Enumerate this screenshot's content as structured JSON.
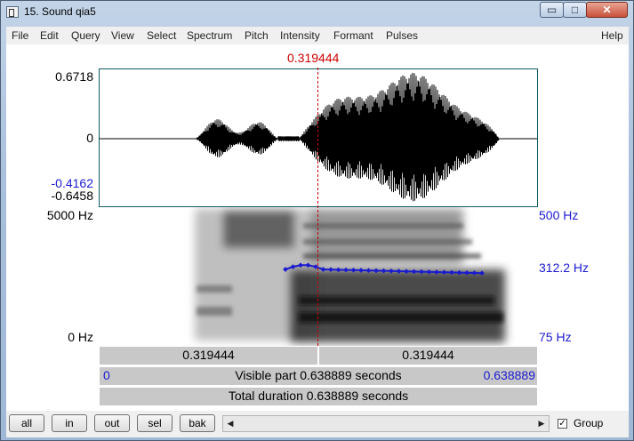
{
  "window": {
    "title": "15. Sound qia5",
    "min": "▭",
    "max": "□",
    "close": "✕"
  },
  "menu": [
    "File",
    "Edit",
    "Query",
    "View",
    "Select",
    "Spectrum",
    "Pitch",
    "Intensity",
    "Formant",
    "Pulses",
    "Help"
  ],
  "cursor": {
    "time": "0.319444"
  },
  "waveform": {
    "top": "0.6718",
    "zero": "0",
    "sel_min": "-0.4162",
    "min": "-0.6458"
  },
  "spectrogram": {
    "top": "5000 Hz",
    "bottom": "0 Hz"
  },
  "pitch": {
    "top": "500 Hz",
    "value": "312.2 Hz",
    "bottom": "75 Hz",
    "color": "#1a1ad0"
  },
  "bars": {
    "left_segment": "0.319444",
    "right_segment": "0.319444",
    "visible_start": "0",
    "visible_text": "Visible part 0.638889 seconds",
    "visible_end": "0.638889",
    "total_text": "Total duration 0.638889 seconds"
  },
  "buttons": {
    "all": "all",
    "in": "in",
    "out": "out",
    "sel": "sel",
    "bak": "bak"
  },
  "group": {
    "label": "Group",
    "checked": true,
    "mark": "✓"
  },
  "scroll": {
    "left": "◀",
    "right": "▶"
  }
}
